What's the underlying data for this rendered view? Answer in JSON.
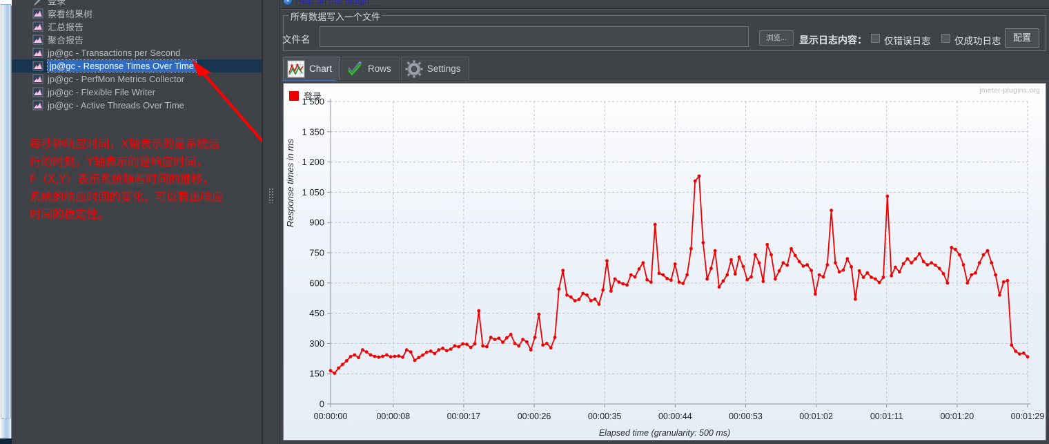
{
  "tree": {
    "items": [
      {
        "label": "登录",
        "icon": "pencil-icon",
        "selected": false,
        "partial": true
      },
      {
        "label": "察看结果树",
        "icon": "chart-icon",
        "selected": false
      },
      {
        "label": "汇总报告",
        "icon": "chart-icon",
        "selected": false
      },
      {
        "label": "聚合报告",
        "icon": "chart-icon",
        "selected": false
      },
      {
        "label": "jp@gc - Transactions per Second",
        "icon": "chart-icon",
        "selected": false
      },
      {
        "label": "jp@gc - Response Times Over Time",
        "icon": "chart-icon",
        "selected": true
      },
      {
        "label": "jp@gc - PerfMon Metrics Collector",
        "icon": "chart-icon",
        "selected": false
      },
      {
        "label": "jp@gc - Flexible File Writer",
        "icon": "chart-icon",
        "selected": false
      },
      {
        "label": "jp@gc - Active Threads Over Time",
        "icon": "chart-icon",
        "selected": false
      }
    ]
  },
  "annotation": {
    "color": "#ff0000",
    "lines": [
      "每秒钟响应时间，X轴表示的是系统运",
      "行的时刻，Y轴表示的是响应时间，",
      "F（X,Y）表示系统随着时间的推移，",
      "系统的响应时间的变化，可以看出响应",
      "时间的稳定性。"
    ]
  },
  "header": {
    "help_link": "Help on this plugin",
    "group_title": "所有数据写入一个文件",
    "filename_label": "文件名",
    "filename_value": "",
    "filename_placeholder": "",
    "browse_button": "浏览...",
    "show_log_label": "显示日志内容：",
    "checkbox_errors_only": "仅错误日志",
    "checkbox_success_only": "仅成功日志",
    "checkbox_errors_checked": false,
    "checkbox_success_checked": false,
    "config_button": "配置"
  },
  "tabs": [
    {
      "label": "Chart",
      "icon": "line-chart-icon",
      "active": true
    },
    {
      "label": "Rows",
      "icon": "green-check-icon",
      "active": false
    },
    {
      "label": "Settings",
      "icon": "gear-icon",
      "active": false
    }
  ],
  "chart_data": {
    "type": "line",
    "title": "",
    "watermark": "jmeter-plugins.org",
    "legend": [
      {
        "name": "登录",
        "color": "#ee0000"
      }
    ],
    "legend_position": "top-left",
    "grid": true,
    "xlabel": "Elapsed time (granularity: 500 ms)",
    "ylabel": "Response times in ms",
    "ylim": [
      0,
      1500
    ],
    "yticks": [
      0,
      150,
      300,
      450,
      600,
      750,
      900,
      1050,
      1200,
      1350,
      1500
    ],
    "ytick_labels": [
      "0",
      "150",
      "300",
      "450",
      "600",
      "750",
      "900",
      "1 050",
      "1 200",
      "1 350",
      "1 500"
    ],
    "xtick_labels": [
      "00:00:00",
      "00:00:08",
      "00:00:17",
      "00:00:26",
      "00:00:35",
      "00:00:44",
      "00:00:53",
      "00:01:02",
      "00:01:11",
      "00:01:20",
      "00:01:29"
    ],
    "xtick_seconds": [
      0,
      8,
      17,
      26,
      35,
      44,
      53,
      62,
      71,
      80,
      89
    ],
    "xlim_seconds": [
      0,
      89
    ],
    "series": [
      {
        "name": "登录",
        "color": "#ee0000",
        "marker": "circle",
        "values": [
          165,
          152,
          178,
          196,
          214,
          235,
          243,
          230,
          268,
          258,
          243,
          236,
          232,
          236,
          243,
          234,
          236,
          238,
          232,
          268,
          258,
          216,
          230,
          242,
          256,
          262,
          250,
          268,
          276,
          264,
          272,
          288,
          284,
          298,
          296,
          280,
          298,
          462,
          288,
          284,
          330,
          320,
          326,
          306,
          328,
          345,
          300,
          288,
          320,
          308,
          268,
          330,
          445,
          292,
          300,
          278,
          330,
          570,
          662,
          540,
          530,
          512,
          518,
          548,
          540,
          512,
          520,
          495,
          565,
          710,
          560,
          620,
          604,
          596,
          590,
          640,
          630,
          670,
          700,
          616,
          604,
          890,
          648,
          640,
          622,
          614,
          694,
          604,
          598,
          640,
          770,
          1105,
          1130,
          800,
          620,
          672,
          760,
          580,
          610,
          640,
          715,
          645,
          728,
          682,
          616,
          630,
          740,
          700,
          608,
          790,
          740,
          620,
          660,
          700,
          688,
          770,
          736,
          706,
          684,
          690,
          662,
          545,
          640,
          630,
          690,
          960,
          700,
          655,
          664,
          720,
          680,
          520,
          660,
          628,
          650,
          628,
          620,
          602,
          628,
          1030,
          636,
          678,
          655,
          696,
          720,
          700,
          720,
          745,
          706,
          690,
          700,
          688,
          672,
          646,
          600,
          776,
          766,
          740,
          690,
          600,
          640,
          650,
          700,
          740,
          760,
          700,
          640,
          540,
          605,
          612,
          292,
          262,
          248,
          252,
          234
        ]
      }
    ]
  }
}
